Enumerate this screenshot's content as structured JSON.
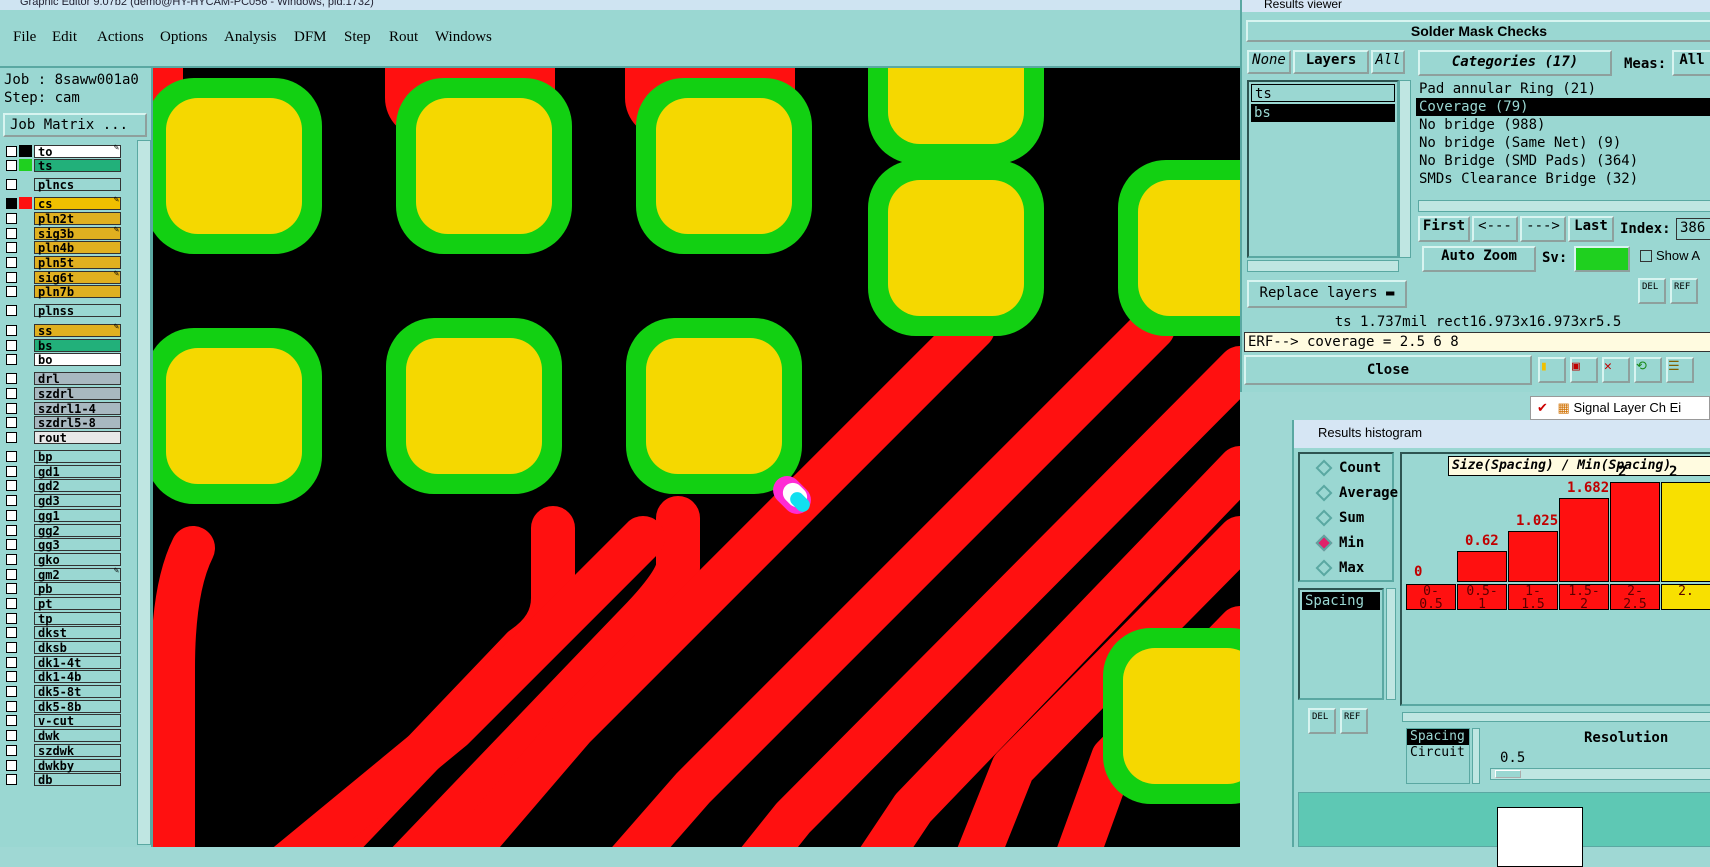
{
  "window_title": "Graphic Editor 9.07b2 (demo@HY-HYCAM-PC056 - Windows, pid:1732)",
  "menu": [
    "File",
    "Edit",
    "Actions",
    "Options",
    "Analysis",
    "DFM",
    "Step",
    "Rout",
    "Windows"
  ],
  "job": {
    "job_line": "Job : 8saww001a0",
    "step_line": "Step: cam",
    "matrix_button": "Job Matrix ..."
  },
  "layers": [
    {
      "name": "to",
      "color": "#ffffff",
      "swatch": "#000000",
      "edit": true
    },
    {
      "name": "ts",
      "color": "#22b07a",
      "swatch": "#1fd01f",
      "edit": false
    },
    {
      "name": "plncs",
      "color": "#9ad7d2",
      "swatch": "",
      "edit": false
    },
    {
      "name": "cs",
      "color": "#f0c000",
      "swatch": "#ff1010",
      "edit": true,
      "selected": true
    },
    {
      "name": "pln2t",
      "color": "#e0b020",
      "swatch": "",
      "edit": false
    },
    {
      "name": "sig3b",
      "color": "#e0b020",
      "swatch": "",
      "edit": true
    },
    {
      "name": "pln4b",
      "color": "#e0b020",
      "swatch": "",
      "edit": false
    },
    {
      "name": "pln5t",
      "color": "#e0b020",
      "swatch": "",
      "edit": false
    },
    {
      "name": "sig6t",
      "color": "#e0b020",
      "swatch": "",
      "edit": true
    },
    {
      "name": "pln7b",
      "color": "#e0b020",
      "swatch": "",
      "edit": false
    },
    {
      "name": "plnss",
      "color": "#9ad7d2",
      "swatch": "",
      "edit": false
    },
    {
      "name": "ss",
      "color": "#e0b020",
      "swatch": "",
      "edit": true
    },
    {
      "name": "bs",
      "color": "#22b07a",
      "swatch": "",
      "edit": false
    },
    {
      "name": "bo",
      "color": "#ffffff",
      "swatch": "",
      "edit": false
    },
    {
      "name": "drl",
      "color": "#a8b8c0",
      "swatch": "",
      "edit": false
    },
    {
      "name": "szdrl",
      "color": "#a8b8c0",
      "swatch": "",
      "edit": false
    },
    {
      "name": "szdrl1-4",
      "color": "#a8b8c0",
      "swatch": "",
      "edit": false
    },
    {
      "name": "szdrl5-8",
      "color": "#a8b8c0",
      "swatch": "",
      "edit": false
    },
    {
      "name": "rout",
      "color": "#e8e8e8",
      "swatch": "",
      "edit": false
    },
    {
      "name": "bp",
      "color": "#9ad7d2",
      "swatch": "",
      "edit": false
    },
    {
      "name": "gd1",
      "color": "#9ad7d2",
      "swatch": "",
      "edit": false
    },
    {
      "name": "gd2",
      "color": "#9ad7d2",
      "swatch": "",
      "edit": false
    },
    {
      "name": "gd3",
      "color": "#9ad7d2",
      "swatch": "",
      "edit": false
    },
    {
      "name": "gg1",
      "color": "#9ad7d2",
      "swatch": "",
      "edit": false
    },
    {
      "name": "gg2",
      "color": "#9ad7d2",
      "swatch": "",
      "edit": false
    },
    {
      "name": "gg3",
      "color": "#9ad7d2",
      "swatch": "",
      "edit": false
    },
    {
      "name": "gko",
      "color": "#9ad7d2",
      "swatch": "",
      "edit": false
    },
    {
      "name": "gm2",
      "color": "#9ad7d2",
      "swatch": "",
      "edit": true
    },
    {
      "name": "pb",
      "color": "#9ad7d2",
      "swatch": "",
      "edit": false
    },
    {
      "name": "pt",
      "color": "#9ad7d2",
      "swatch": "",
      "edit": false
    },
    {
      "name": "tp",
      "color": "#9ad7d2",
      "swatch": "",
      "edit": false
    },
    {
      "name": "dkst",
      "color": "#9ad7d2",
      "swatch": "",
      "edit": false
    },
    {
      "name": "dksb",
      "color": "#9ad7d2",
      "swatch": "",
      "edit": false
    },
    {
      "name": "dk1-4t",
      "color": "#9ad7d2",
      "swatch": "",
      "edit": false
    },
    {
      "name": "dk1-4b",
      "color": "#9ad7d2",
      "swatch": "",
      "edit": false
    },
    {
      "name": "dk5-8t",
      "color": "#9ad7d2",
      "swatch": "",
      "edit": false
    },
    {
      "name": "dk5-8b",
      "color": "#9ad7d2",
      "swatch": "",
      "edit": false
    },
    {
      "name": "v-cut",
      "color": "#9ad7d2",
      "swatch": "",
      "edit": false
    },
    {
      "name": "dwk",
      "color": "#9ad7d2",
      "swatch": "",
      "edit": false
    },
    {
      "name": "szdwk",
      "color": "#9ad7d2",
      "swatch": "",
      "edit": false
    },
    {
      "name": "dwkby",
      "color": "#9ad7d2",
      "swatch": "",
      "edit": false
    },
    {
      "name": "db",
      "color": "#9ad7d2",
      "swatch": "",
      "edit": false
    }
  ],
  "results_viewer": {
    "title": "Results viewer",
    "header": "Solder Mask Checks",
    "none_btn": "None",
    "layers_btn": "Layers",
    "all_btn": "All",
    "layer_list": [
      "ts",
      "bs"
    ],
    "categories_btn": "Categories (17)",
    "meas_label": "Meas:",
    "meas_all": "All",
    "categories": [
      "Pad annular Ring (21)",
      "Coverage (79)",
      "No bridge (988)",
      "No bridge (Same Net) (9)",
      "No Bridge (SMD Pads) (364)",
      "SMDs Clearance Bridge (32)"
    ],
    "selected_category": 1,
    "first_btn": "First",
    "prev_btn": "<---",
    "next_btn": "--->",
    "last_btn": "Last",
    "index_label": "Index:",
    "index_value": "386",
    "autozoom": "Auto Zoom",
    "sv_label": "Sv:",
    "show_label": "Show A",
    "replace_layers": "Replace layers",
    "status": "ts 1.737mil  rect16.973x16.973xr5.5",
    "erf": "ERF--> coverage = 2.5 6 8",
    "close_btn": "Close",
    "signal_check": "Signal Layer Ch Ei"
  },
  "histogram": {
    "title": "Results histogram",
    "modes": [
      "Count",
      "Average",
      "Sum",
      "Min",
      "Max"
    ],
    "selected_mode": "Min",
    "list_item": "Spacing",
    "chart_title": "Size(Spacing) / Min(Spacing)",
    "bins": [
      "0-\n0.5",
      "0.5-\n1",
      "1-\n1.5",
      "1.5-\n2",
      "2-\n2.5",
      "2."
    ],
    "bar_values": [
      "0",
      "0.62",
      "1.025",
      "1.682",
      "2",
      "2"
    ],
    "bar_numeric": [
      0,
      0.62,
      1.025,
      1.682,
      2,
      2
    ],
    "bar_colors": [
      "#ff1010",
      "#ff1010",
      "#ff1010",
      "#ff1010",
      "#ff1010",
      "#f8e000"
    ],
    "lower_list": [
      "Spacing",
      "Circuit"
    ],
    "resolution_label": "Resolution",
    "resolution_value": "0.5",
    "del_label": "DEL",
    "ref_label": "REF"
  }
}
